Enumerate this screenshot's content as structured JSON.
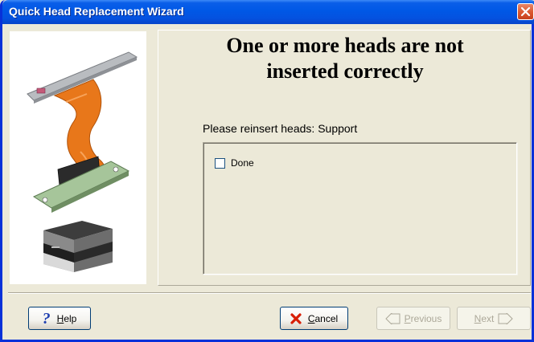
{
  "window": {
    "title": "Quick Head Replacement Wizard"
  },
  "illustrations": {
    "top": "print-head-with-ribbon-cable",
    "bottom": "printer"
  },
  "main": {
    "heading_line1": "One or more heads are not",
    "heading_line2": "inserted correctly",
    "instructions": "Please reinsert heads: Support",
    "checkbox": {
      "label": "Done",
      "checked": false
    }
  },
  "footer": {
    "help_label": "Help",
    "cancel_label": "Cancel",
    "previous_label": "Previous",
    "next_label": "Next"
  },
  "colors": {
    "titlebar": "#0058e6",
    "window_bg": "#ece9d8",
    "close_button": "#dc5a32",
    "ribbon_cable": "#e8771a"
  }
}
